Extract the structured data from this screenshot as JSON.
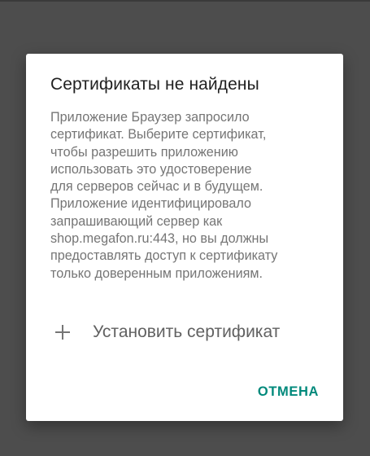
{
  "dialog": {
    "title": "Сертификаты не найдены",
    "message_lines": [
      "Приложение Браузер запросило",
      "сертификат. Выберите сертификат,",
      "чтобы разрешить приложению",
      "использовать это удостоверение",
      "для серверов сейчас и в будущем.",
      "Приложение идентифицировало",
      "запрашивающий сервер как",
      "shop.megafon.ru:443, но вы должны",
      "предоставлять доступ к сертификату",
      "только доверенным приложениям."
    ],
    "install_label": "Установить сертификат",
    "install_icon": "plus-icon",
    "cancel_label": "ОТМЕНА",
    "accent_color": "#00897b"
  }
}
